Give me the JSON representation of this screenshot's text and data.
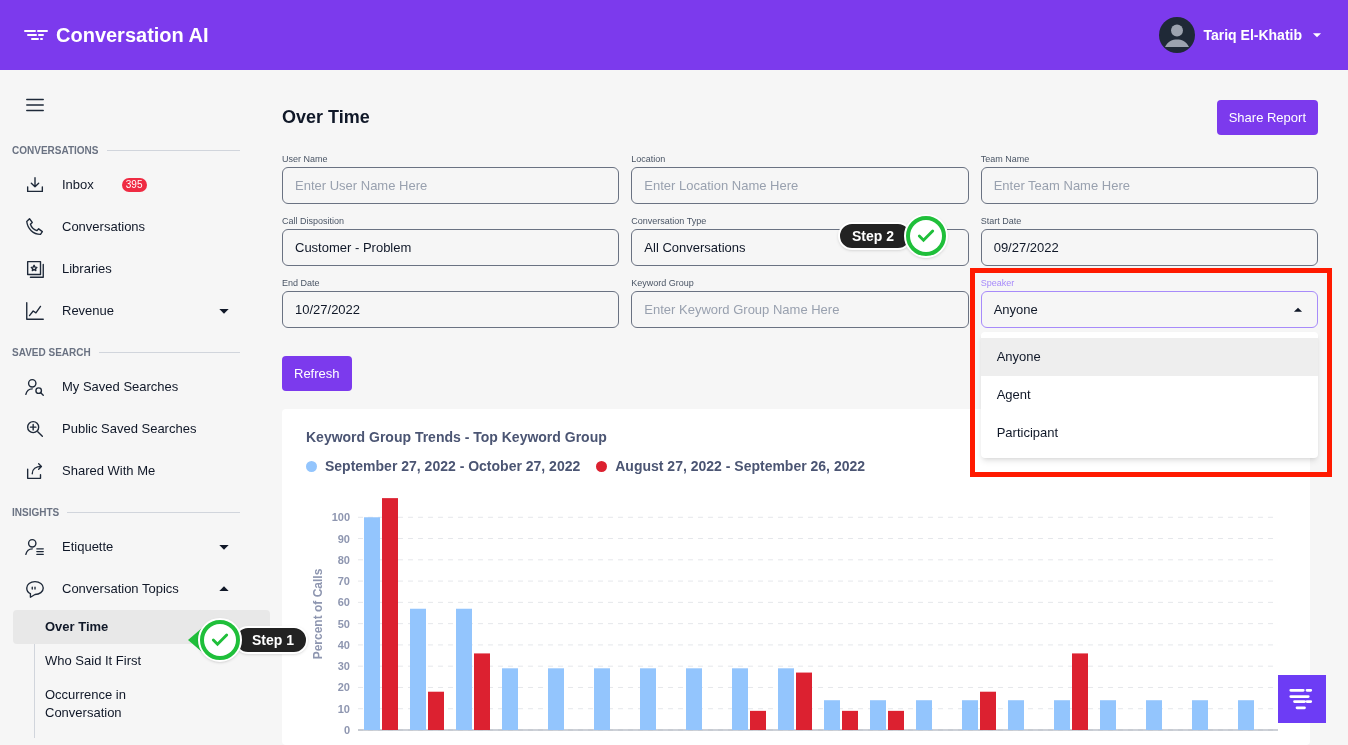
{
  "header": {
    "app_title": "Conversation AI",
    "user_name": "Tariq El-Khatib"
  },
  "sidebar": {
    "sections": [
      {
        "heading": "CONVERSATIONS",
        "items": [
          {
            "label": "Inbox",
            "badge": "395",
            "selected": false
          },
          {
            "label": "Conversations",
            "selected": false
          },
          {
            "label": "Libraries",
            "selected": false
          },
          {
            "label": "Revenue",
            "expanded": false,
            "selected": false
          }
        ]
      },
      {
        "heading": "SAVED SEARCH",
        "items": [
          {
            "label": "My Saved Searches",
            "selected": false
          },
          {
            "label": "Public Saved Searches",
            "selected": false
          },
          {
            "label": "Shared With Me",
            "selected": false
          }
        ]
      },
      {
        "heading": "INSIGHTS",
        "items": [
          {
            "label": "Etiquette",
            "expanded": false,
            "selected": false
          },
          {
            "label": "Conversation Topics",
            "expanded": true,
            "selected": false,
            "children": [
              {
                "label": "Over Time",
                "selected": true
              },
              {
                "label": "Who Said It First",
                "selected": false
              },
              {
                "label": "Occurrence in Conversation",
                "selected": false
              }
            ]
          }
        ]
      }
    ]
  },
  "page": {
    "title": "Over Time",
    "share_button": "Share Report",
    "refresh_button": "Refresh"
  },
  "filters": [
    {
      "kind": "text",
      "label": "User Name",
      "placeholder": "Enter User Name Here"
    },
    {
      "kind": "text",
      "label": "Location",
      "placeholder": "Enter Location Name Here"
    },
    {
      "kind": "text",
      "label": "Team Name",
      "placeholder": "Enter Team Name Here"
    },
    {
      "kind": "text",
      "label": "Call Disposition",
      "value": "Customer - Problem"
    },
    {
      "kind": "text",
      "label": "Conversation Type",
      "value": "All Conversations"
    },
    {
      "kind": "text",
      "label": "Start Date",
      "value": "09/27/2022"
    },
    {
      "kind": "text",
      "label": "End Date",
      "value": "10/27/2022"
    },
    {
      "kind": "text",
      "label": "Keyword Group",
      "placeholder": "Enter Keyword Group Name Here"
    },
    {
      "kind": "select",
      "label": "Speaker",
      "value": "Anyone",
      "expanded": true,
      "options": [
        {
          "label": "Anyone",
          "selected": true
        },
        {
          "label": "Agent",
          "selected": false
        },
        {
          "label": "Participant",
          "selected": false
        }
      ]
    }
  ],
  "chart": {
    "chart_data": {
      "type": "bar",
      "title": "Keyword Group Trends - Top Keyword Group",
      "ylabel": "Percent of Calls",
      "ylim": [
        0,
        110
      ],
      "yticks": [
        0,
        10,
        20,
        30,
        40,
        50,
        60,
        70,
        80,
        90,
        100
      ],
      "grid": true,
      "series": [
        {
          "name": "September 27, 2022 - October 27, 2022",
          "color": "#93c5fd",
          "values": [
            100,
            57,
            57,
            29,
            29,
            29,
            29,
            29,
            29,
            29,
            14,
            14,
            14,
            14,
            14,
            14,
            14,
            14,
            14,
            14
          ]
        },
        {
          "name": "August 27, 2022 - September 26, 2022",
          "color": "#dc2130",
          "values": [
            109,
            18,
            36,
            0,
            0,
            0,
            0,
            0,
            9,
            27,
            9,
            9,
            0,
            18,
            0,
            36,
            0,
            0,
            0,
            0
          ]
        }
      ]
    }
  },
  "callouts": [
    {
      "label": "Step 1"
    },
    {
      "label": "Step 2"
    }
  ]
}
